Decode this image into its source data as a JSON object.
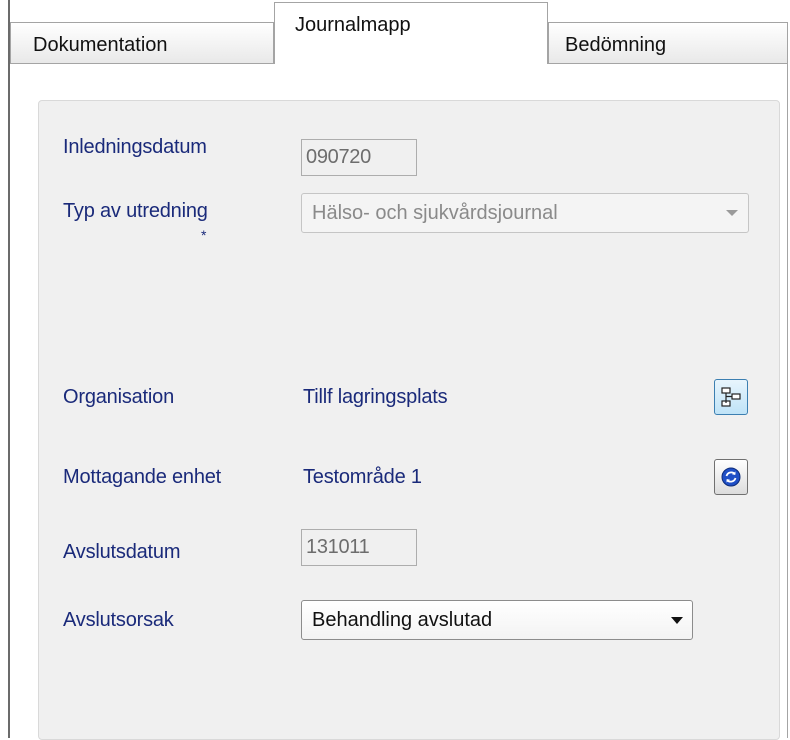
{
  "tabs": [
    {
      "label": "Dokumentation"
    },
    {
      "label": "Journalmapp"
    },
    {
      "label": "Bedömning"
    }
  ],
  "form": {
    "inledningsdatum_label": "Inledningsdatum",
    "inledningsdatum_value": "090720",
    "typ_label": "Typ av utredning",
    "typ_required": "*",
    "typ_value": "Hälso- och sjukvårdsjournal",
    "organisation_label": "Organisation",
    "organisation_value": "Tillf lagringsplats",
    "mottagande_label": "Mottagande enhet",
    "mottagande_value": "Testområde 1",
    "avslutsdatum_label": "Avslutsdatum",
    "avslutsdatum_value": "131011",
    "avslutsorsak_label": "Avslutsorsak",
    "avslutsorsak_value": "Behandling avslutad"
  },
  "icons": {
    "organisation_button": "org-tree-icon",
    "mottagande_button": "refresh-icon"
  },
  "colors": {
    "label_text": "#1a2a7a",
    "group_background": "#f0f0f0",
    "disabled_text": "#8a8a8a"
  }
}
